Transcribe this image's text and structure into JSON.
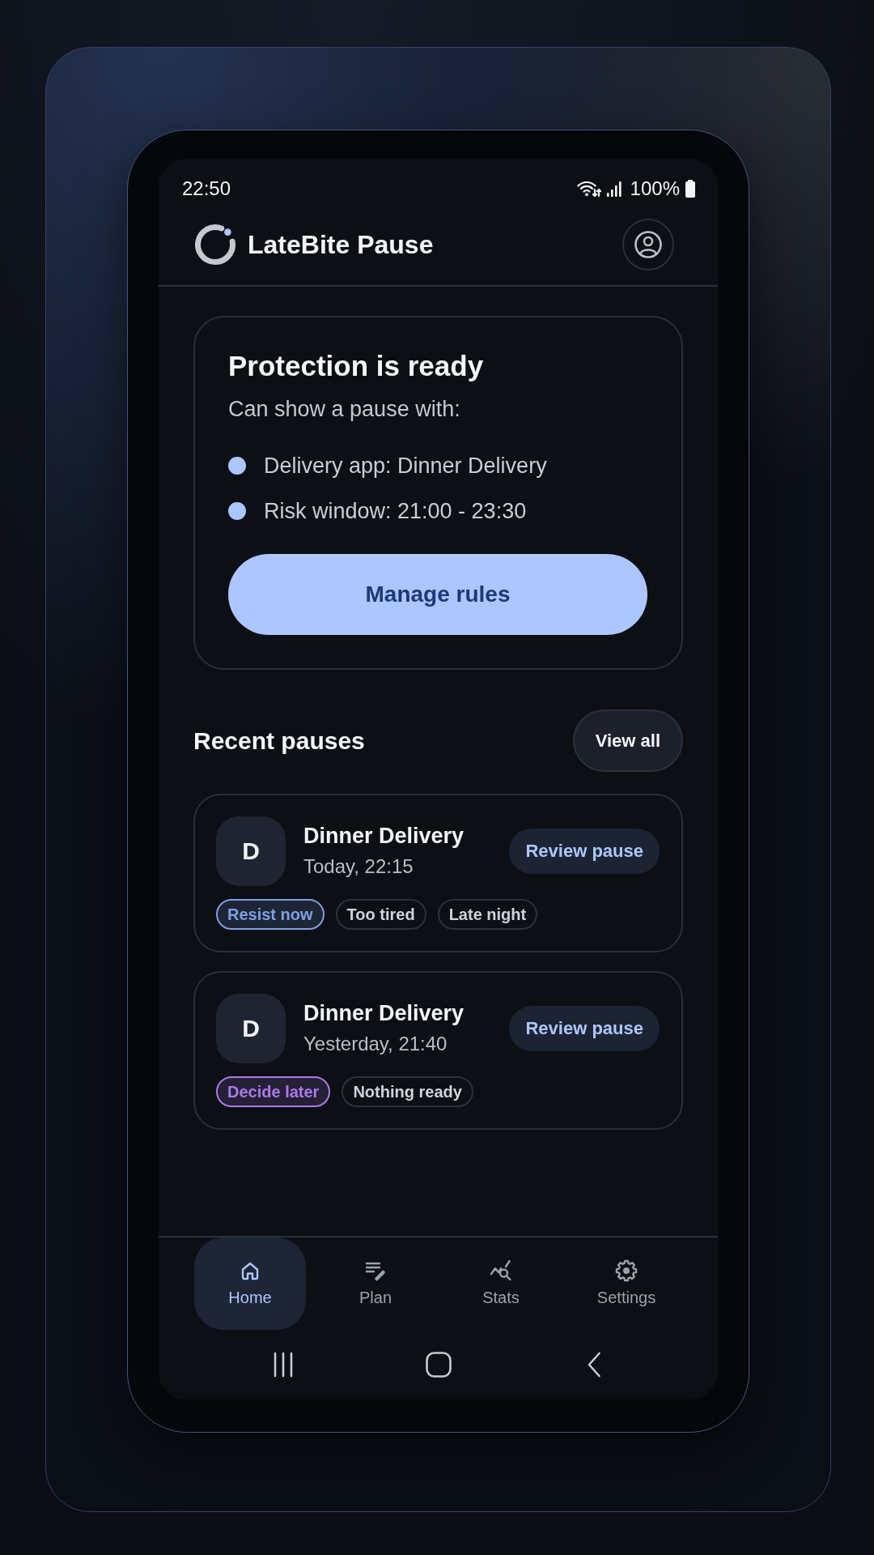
{
  "status_bar": {
    "time": "22:50",
    "battery": "100%"
  },
  "app_bar": {
    "title": "LateBite Pause"
  },
  "protection_card": {
    "title": "Protection is ready",
    "subtitle": "Can show a pause with:",
    "conditions": [
      "Delivery app: Dinner Delivery",
      "Risk window: 21:00 - 23:30"
    ],
    "button": "Manage rules"
  },
  "recent_pauses": {
    "title": "Recent pauses",
    "view_all": "View all",
    "items": [
      {
        "initial": "D",
        "app": "Dinner Delivery",
        "time": "Today, 22:15",
        "action": "Review pause",
        "tags": [
          {
            "label": "Resist now",
            "kind": "decision",
            "color": "#7f9fe6"
          },
          {
            "label": "Too tired",
            "kind": "reason"
          },
          {
            "label": "Late night",
            "kind": "reason"
          }
        ]
      },
      {
        "initial": "D",
        "app": "Dinner Delivery",
        "time": "Yesterday, 21:40",
        "action": "Review pause",
        "tags": [
          {
            "label": "Decide later",
            "kind": "decision",
            "color": "#a97be8"
          },
          {
            "label": "Nothing ready",
            "kind": "reason"
          }
        ]
      }
    ]
  },
  "bottom_nav": [
    {
      "label": "Home",
      "selected": true
    },
    {
      "label": "Plan",
      "selected": false
    },
    {
      "label": "Stats",
      "selected": false
    },
    {
      "label": "Settings",
      "selected": false
    }
  ]
}
